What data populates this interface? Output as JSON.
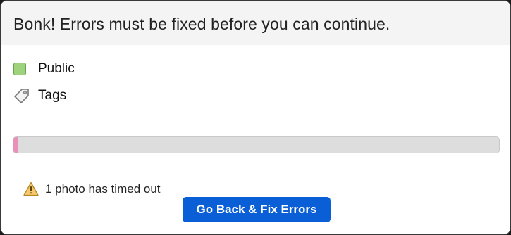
{
  "dialog": {
    "title": "Bonk! Errors must be fixed before you can continue."
  },
  "fields": {
    "privacy": {
      "label": "Public",
      "icon": "privacy-square-icon",
      "color": "#9fd27c"
    },
    "tags": {
      "label": "Tags",
      "icon": "tag-icon"
    }
  },
  "upload": {
    "progress_percent": 1,
    "progress_color": "#ea8fba"
  },
  "error": {
    "icon": "warning-icon",
    "message": "1 photo has timed out"
  },
  "actions": {
    "fix_errors_label": "Go Back & Fix Errors",
    "accent_color": "#0a5fd6"
  }
}
